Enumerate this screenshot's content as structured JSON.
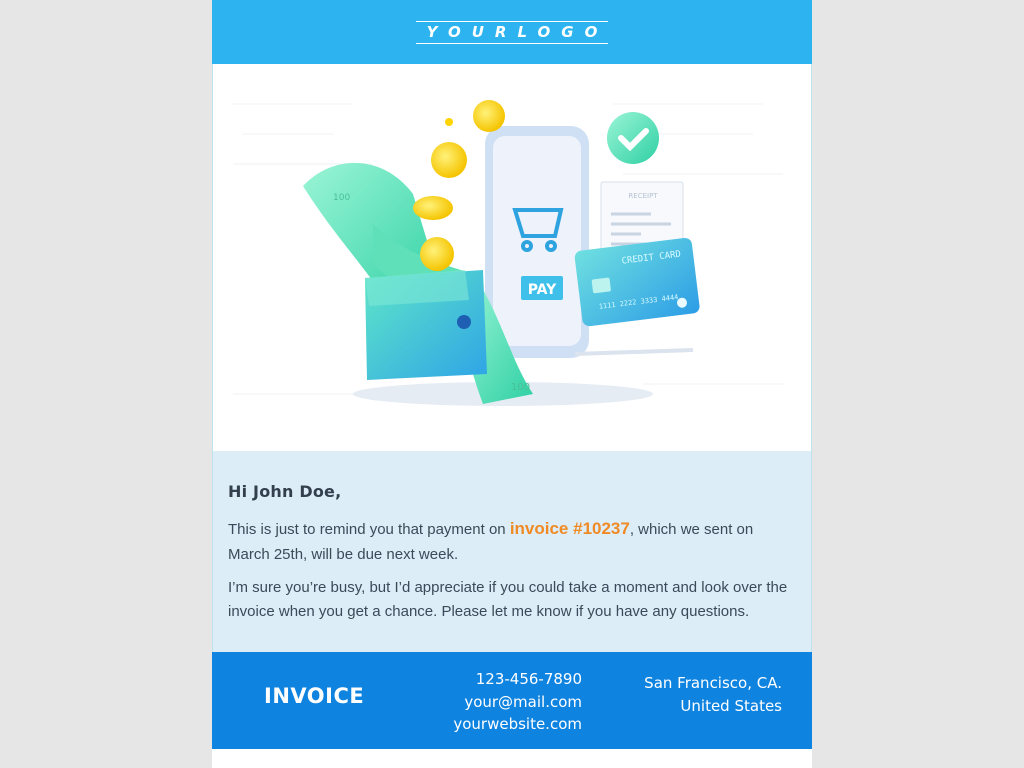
{
  "header": {
    "logo_text": "YOURLOGO"
  },
  "hero": {
    "pay_label": "PAY",
    "card_label": "CREDIT CARD",
    "card_number": "1111 2222 3333 4444",
    "receipt_label": "RECEIPT",
    "banknote_value": "100"
  },
  "message": {
    "greeting": "Hi John Doe,",
    "para1_before": " This is just to remind you that payment on ",
    "invoice_link": "invoice #10237",
    "para1_after": ", which we sent on March 25th, will be due next week.",
    "para2": "I’m sure you’re busy, but I’d appreciate if you could take a moment and look over the invoice when you get a chance. Please let me know if you have any questions."
  },
  "footer": {
    "title": "INVOICE",
    "phone": "123-456-7890",
    "email": "your@mail.com",
    "website": "yourwebsite.com",
    "city": "San Francisco, CA.",
    "country": "United States"
  },
  "colors": {
    "header_bg": "#2cb3f0",
    "footer_bg": "#0f83e0",
    "link": "#f08a24",
    "message_bg": "#dcedf8"
  }
}
